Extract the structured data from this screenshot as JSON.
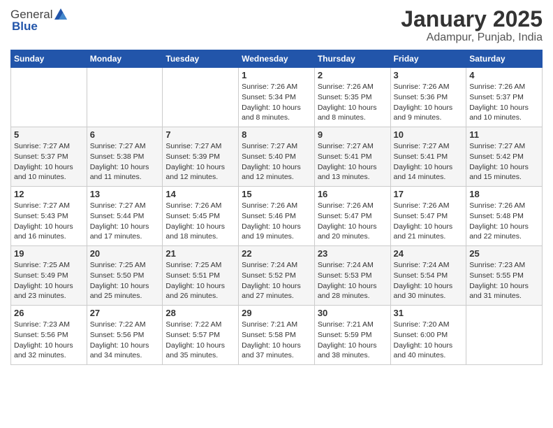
{
  "header": {
    "logo_general": "General",
    "logo_blue": "Blue",
    "title": "January 2025",
    "subtitle": "Adampur, Punjab, India"
  },
  "calendar": {
    "weekdays": [
      "Sunday",
      "Monday",
      "Tuesday",
      "Wednesday",
      "Thursday",
      "Friday",
      "Saturday"
    ],
    "weeks": [
      [
        {
          "day": "",
          "info": ""
        },
        {
          "day": "",
          "info": ""
        },
        {
          "day": "",
          "info": ""
        },
        {
          "day": "1",
          "info": "Sunrise: 7:26 AM\nSunset: 5:34 PM\nDaylight: 10 hours\nand 8 minutes."
        },
        {
          "day": "2",
          "info": "Sunrise: 7:26 AM\nSunset: 5:35 PM\nDaylight: 10 hours\nand 8 minutes."
        },
        {
          "day": "3",
          "info": "Sunrise: 7:26 AM\nSunset: 5:36 PM\nDaylight: 10 hours\nand 9 minutes."
        },
        {
          "day": "4",
          "info": "Sunrise: 7:26 AM\nSunset: 5:37 PM\nDaylight: 10 hours\nand 10 minutes."
        }
      ],
      [
        {
          "day": "5",
          "info": "Sunrise: 7:27 AM\nSunset: 5:37 PM\nDaylight: 10 hours\nand 10 minutes."
        },
        {
          "day": "6",
          "info": "Sunrise: 7:27 AM\nSunset: 5:38 PM\nDaylight: 10 hours\nand 11 minutes."
        },
        {
          "day": "7",
          "info": "Sunrise: 7:27 AM\nSunset: 5:39 PM\nDaylight: 10 hours\nand 12 minutes."
        },
        {
          "day": "8",
          "info": "Sunrise: 7:27 AM\nSunset: 5:40 PM\nDaylight: 10 hours\nand 12 minutes."
        },
        {
          "day": "9",
          "info": "Sunrise: 7:27 AM\nSunset: 5:41 PM\nDaylight: 10 hours\nand 13 minutes."
        },
        {
          "day": "10",
          "info": "Sunrise: 7:27 AM\nSunset: 5:41 PM\nDaylight: 10 hours\nand 14 minutes."
        },
        {
          "day": "11",
          "info": "Sunrise: 7:27 AM\nSunset: 5:42 PM\nDaylight: 10 hours\nand 15 minutes."
        }
      ],
      [
        {
          "day": "12",
          "info": "Sunrise: 7:27 AM\nSunset: 5:43 PM\nDaylight: 10 hours\nand 16 minutes."
        },
        {
          "day": "13",
          "info": "Sunrise: 7:27 AM\nSunset: 5:44 PM\nDaylight: 10 hours\nand 17 minutes."
        },
        {
          "day": "14",
          "info": "Sunrise: 7:26 AM\nSunset: 5:45 PM\nDaylight: 10 hours\nand 18 minutes."
        },
        {
          "day": "15",
          "info": "Sunrise: 7:26 AM\nSunset: 5:46 PM\nDaylight: 10 hours\nand 19 minutes."
        },
        {
          "day": "16",
          "info": "Sunrise: 7:26 AM\nSunset: 5:47 PM\nDaylight: 10 hours\nand 20 minutes."
        },
        {
          "day": "17",
          "info": "Sunrise: 7:26 AM\nSunset: 5:47 PM\nDaylight: 10 hours\nand 21 minutes."
        },
        {
          "day": "18",
          "info": "Sunrise: 7:26 AM\nSunset: 5:48 PM\nDaylight: 10 hours\nand 22 minutes."
        }
      ],
      [
        {
          "day": "19",
          "info": "Sunrise: 7:25 AM\nSunset: 5:49 PM\nDaylight: 10 hours\nand 23 minutes."
        },
        {
          "day": "20",
          "info": "Sunrise: 7:25 AM\nSunset: 5:50 PM\nDaylight: 10 hours\nand 25 minutes."
        },
        {
          "day": "21",
          "info": "Sunrise: 7:25 AM\nSunset: 5:51 PM\nDaylight: 10 hours\nand 26 minutes."
        },
        {
          "day": "22",
          "info": "Sunrise: 7:24 AM\nSunset: 5:52 PM\nDaylight: 10 hours\nand 27 minutes."
        },
        {
          "day": "23",
          "info": "Sunrise: 7:24 AM\nSunset: 5:53 PM\nDaylight: 10 hours\nand 28 minutes."
        },
        {
          "day": "24",
          "info": "Sunrise: 7:24 AM\nSunset: 5:54 PM\nDaylight: 10 hours\nand 30 minutes."
        },
        {
          "day": "25",
          "info": "Sunrise: 7:23 AM\nSunset: 5:55 PM\nDaylight: 10 hours\nand 31 minutes."
        }
      ],
      [
        {
          "day": "26",
          "info": "Sunrise: 7:23 AM\nSunset: 5:56 PM\nDaylight: 10 hours\nand 32 minutes."
        },
        {
          "day": "27",
          "info": "Sunrise: 7:22 AM\nSunset: 5:56 PM\nDaylight: 10 hours\nand 34 minutes."
        },
        {
          "day": "28",
          "info": "Sunrise: 7:22 AM\nSunset: 5:57 PM\nDaylight: 10 hours\nand 35 minutes."
        },
        {
          "day": "29",
          "info": "Sunrise: 7:21 AM\nSunset: 5:58 PM\nDaylight: 10 hours\nand 37 minutes."
        },
        {
          "day": "30",
          "info": "Sunrise: 7:21 AM\nSunset: 5:59 PM\nDaylight: 10 hours\nand 38 minutes."
        },
        {
          "day": "31",
          "info": "Sunrise: 7:20 AM\nSunset: 6:00 PM\nDaylight: 10 hours\nand 40 minutes."
        },
        {
          "day": "",
          "info": ""
        }
      ]
    ]
  }
}
